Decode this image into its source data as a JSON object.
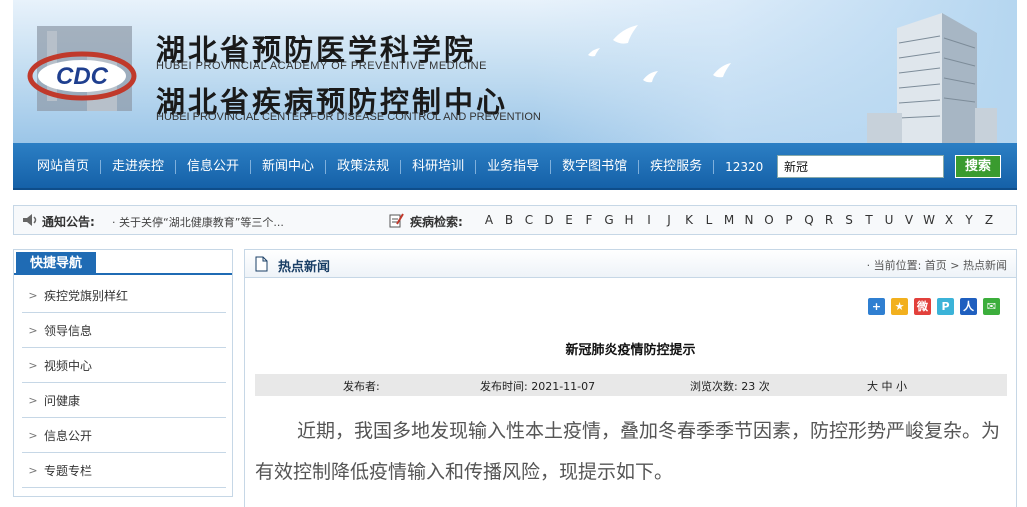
{
  "header": {
    "title_cn_1": "湖北省预防医学科学院",
    "title_en_1": "HUBEI PROVINCIAL ACADEMY OF PREVENTIVE MEDICINE",
    "title_cn_2": "湖北省疾病预防控制中心",
    "title_en_2": "HUBEI PROVINCIAL CENTER FOR DISEASE CONTROL AND PREVENTION",
    "logo_text": "CDC"
  },
  "nav": {
    "items": [
      "网站首页",
      "走进疾控",
      "信息公开",
      "新闻中心",
      "政策法规",
      "科研培训",
      "业务指导",
      "数字图书馆",
      "疾控服务",
      "12320"
    ],
    "search_value": "新冠",
    "search_button": "搜索"
  },
  "notice": {
    "label": "通知公告:",
    "text": "· 关于关停“湖北健康教育”等三个...",
    "disease_label": "疾病检索:",
    "letters": [
      "A",
      "B",
      "C",
      "D",
      "E",
      "F",
      "G",
      "H",
      "I",
      "J",
      "K",
      "L",
      "M",
      "N",
      "O",
      "P",
      "Q",
      "R",
      "S",
      "T",
      "U",
      "V",
      "W",
      "X",
      "Y",
      "Z"
    ]
  },
  "sidebar": {
    "title": "快捷导航",
    "items": [
      "疾控党旗别样红",
      "领导信息",
      "视频中心",
      "问健康",
      "信息公开",
      "专题专栏"
    ]
  },
  "main": {
    "section_title": "热点新闻",
    "breadcrumb": "· 当前位置: 首页 > 热点新闻",
    "article_title": "新冠肺炎疫情防控提示",
    "publisher_label": "发布者:",
    "publish_time": "发布时间: 2021-11-07",
    "views": "浏览次数: 23 次",
    "font_size": "大 中 小",
    "body": "近期，我国多地发现输入性本土疫情，叠加冬春季季节因素，防控形势严峻复杂。为有效控制降低疫情输入和传播风险，现提示如下。"
  },
  "colors": {
    "nav_blue": "#1f6bb4",
    "search_green": "#3a9b2f"
  }
}
